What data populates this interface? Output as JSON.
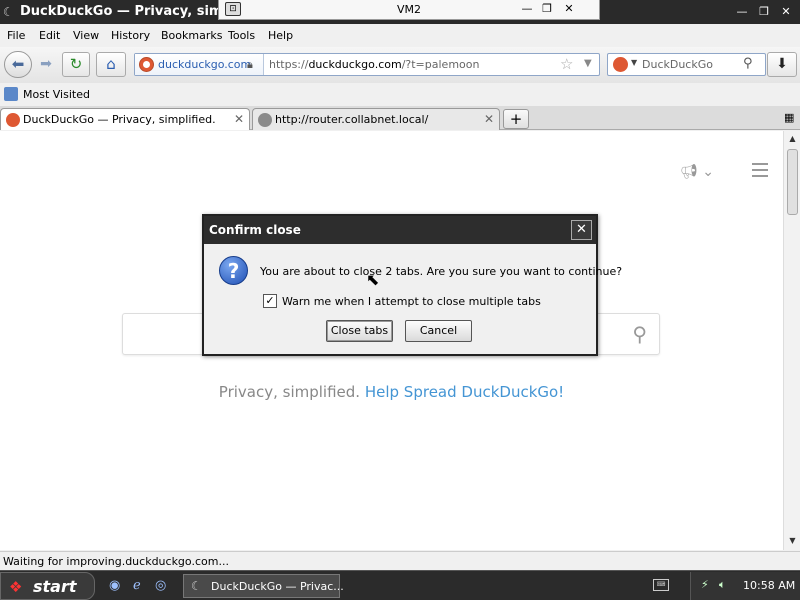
{
  "window": {
    "title": "DuckDuckGo — Privacy, simplif",
    "minimize_label": "—",
    "maximize_label": "❐",
    "close_label": "✕"
  },
  "vm_bar": {
    "title": "VM2",
    "minimize_label": "—",
    "restore_label": "❐",
    "close_label": "✕"
  },
  "menu": {
    "items": [
      "File",
      "Edit",
      "View",
      "History",
      "Bookmarks",
      "Tools",
      "Help"
    ]
  },
  "nav": {
    "identity_host": "duckduckgo.com",
    "url_prefix": "https://",
    "url_host": "duckduckgo.com",
    "url_rest": "/?t=palemoon",
    "search_placeholder": "DuckDuckGo"
  },
  "bookmarks": {
    "most_visited": "Most Visited"
  },
  "tabs": [
    {
      "label": "DuckDuckGo — Privacy, simplified.",
      "active": true
    },
    {
      "label": "http://router.collabnet.local/",
      "active": false
    }
  ],
  "page": {
    "tagline_plain": "Privacy, simplified.",
    "tagline_link": "Help Spread DuckDuckGo!"
  },
  "status": {
    "text": "Waiting for improving.duckduckgo.com..."
  },
  "dialog": {
    "title": "Confirm close",
    "message": "You are about to close 2 tabs. Are you sure you want to continue?",
    "checkbox_label": "Warn me when I attempt to close multiple tabs",
    "checkbox_checked": true,
    "confirm_button": "Close tabs",
    "cancel_button": "Cancel"
  },
  "taskbar": {
    "start_label": "start",
    "task_label": "DuckDuckGo — Privac...",
    "clock": "10:58 AM"
  },
  "colors": {
    "ddg_orange": "#de5833",
    "link_blue": "#4495d4",
    "dialog_titlebar": "#2d2d2d"
  }
}
